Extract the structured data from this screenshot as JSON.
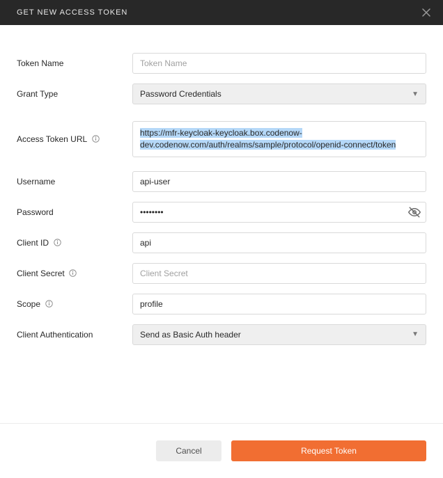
{
  "header": {
    "title": "GET NEW ACCESS TOKEN"
  },
  "form": {
    "token_name": {
      "label": "Token Name",
      "placeholder": "Token Name",
      "value": ""
    },
    "grant_type": {
      "label": "Grant Type",
      "value": "Password Credentials"
    },
    "access_token_url": {
      "label": "Access Token URL",
      "value": "https://mfr-keycloak-keycloak.box.codenow-dev.codenow.com/auth/realms/sample/protocol/openid-connect/token"
    },
    "username": {
      "label": "Username",
      "value": "api-user"
    },
    "password": {
      "label": "Password",
      "mask": "••••••••"
    },
    "client_id": {
      "label": "Client ID",
      "value": "api"
    },
    "client_secret": {
      "label": "Client Secret",
      "placeholder": "Client Secret",
      "value": ""
    },
    "scope": {
      "label": "Scope",
      "value": "profile"
    },
    "client_auth": {
      "label": "Client Authentication",
      "value": "Send as Basic Auth header"
    }
  },
  "footer": {
    "cancel": "Cancel",
    "request": "Request Token"
  }
}
